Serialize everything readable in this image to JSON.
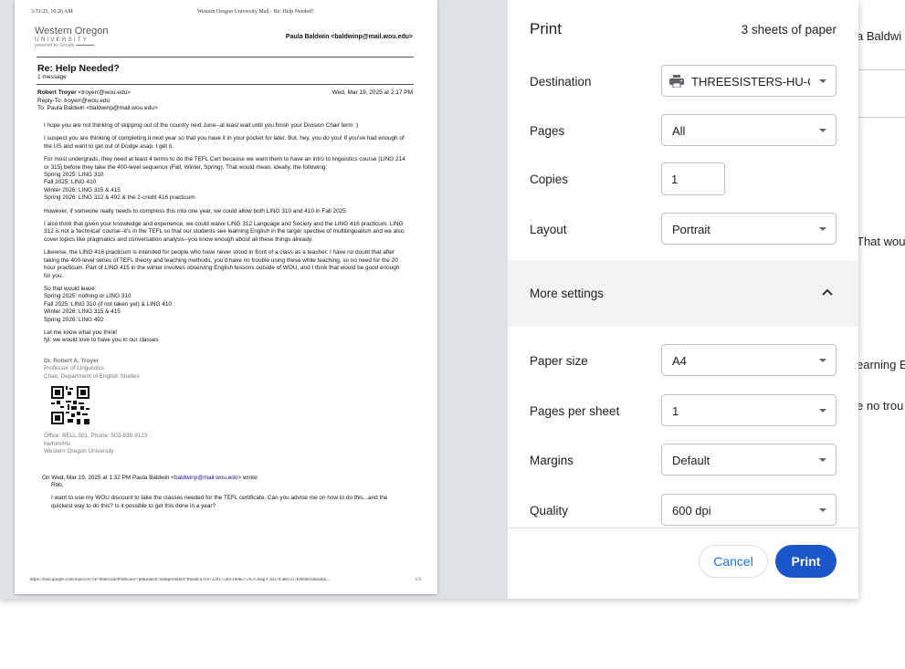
{
  "background": {
    "fragments": [
      "a Baldwi",
      "That woul",
      "earning E",
      "e no trou"
    ]
  },
  "preview": {
    "header_datetime": "3/31/25, 10:26 AM",
    "header_title": "Western Oregon University Mail - Re: Help Needed?",
    "logo": {
      "line1": "Western Oregon",
      "line2": "UNIVERSITY",
      "line3": "powered by Google"
    },
    "user": "Paula Baldwin <baldwinp@mail.wou.edu>",
    "subject": "Re: Help Needed?",
    "message_count": "1 message",
    "from_name": "Robert Troyer",
    "from_email": " <troyerr@wou.edu>",
    "reply_to": "Reply-To: troyerr@wou.edu",
    "to": "To: Paula Baldwin <baldwinp@mail.wou.edu>",
    "date": "Wed, Mar 19, 2025 at 2:17 PM",
    "paragraphs": [
      "I hope you are not thinking of skipping out of the country next June--at least wait until you finish your Division Chair term :)",
      "I suspect you are thinking of completing it next year so that you have it in your pocket for later. But, hey, you do you! If you've had enough of the US and want to get out of Dodge asap, I get it.",
      "For most undergrads, they need at least 4 terms to do the TEFL Cert because we want them to have an intro to linguistics course (LING 214 or 315) before they take the 400-level sequence (Fall, Winter, Spring). That would mean, ideally, the following:\nSpring 2025: LING 310\nFall 2025: LING 410\nWinter 2026: LING 315 & 415\nSpring 2026: LING 312 & 492 & the 2-credit 416 practicum",
      "However, if someone really needs to compress this into one year, we could allow both LING 310 and 410 in Fall 2025.",
      "I also think that given your knowledge and experience, we could waive LING 312 Language and Society and the LING 416 practicum. LING 312 is not a 'technical' course--it's in the TEFL so that our students see learning English in the larger spective of multilingualism and we also cover topics like pragmatics and conversation analysis--you know enough about all these things already.",
      "Likewise, the LING 416 practicum is intended for people who have never stood in front of a class as a teacher. I have no doubt that after taking the 400-level series of TEFL theory and teaching methods, you'd have no trouble using these while teaching, so no need for the 20 hour practicum. Part of LING 415 in the winter involves observing English lessons outside of WOU, and I think that would be good enough for you.",
      "So that would leave:\nSpring 2025: nothing or LING 310\nFall 2025: LING 310 (if not taken yet) & LING 410\nWinter 2026: LING 315 & 415\nSpring 2026: LING 492",
      "Let me know what you think!\nfyi: we would love to have you in our classes"
    ],
    "signature": {
      "name": "Dr. Robert A. Troyer",
      "title": "Professor of Linguistics",
      "dept": "Chair, Department of English Studies",
      "office": "Office: BELL 301, Phone: 503-838-9123",
      "pronouns": "he/him/his",
      "university": "Western Oregon University"
    },
    "quoted_header_pre": "On Wed, Mar 19, 2025 at 1:32 PM Paula Baldwin <",
    "quoted_header_email": "baldwinp@mail.wou.edu",
    "quoted_header_post": "> wrote:",
    "quoted_greeting": "Rob,",
    "quoted_text": "I want to use my WOU discount to take the classes needed for the TEFL certificate.  Can you advise me on how to do this...and the quickest way to do this? Is it possible to get this done in a year?",
    "footer_url": "https://mail.google.com/mail/u/0/?ik=8ba054d0f69&view=pt&search=all&permthid=thread-a:r1673201754851888275%7Cmsg-f:1827058813178484605&simpl...",
    "footer_page": "1/3"
  },
  "settings": {
    "title": "Print",
    "sheets": "3 sheets of paper",
    "destination_label": "Destination",
    "destination_value": "THREESISTERS-HU-C",
    "pages_label": "Pages",
    "pages_value": "All",
    "copies_label": "Copies",
    "copies_value": "1",
    "layout_label": "Layout",
    "layout_value": "Portrait",
    "more_settings_label": "More settings",
    "paper_size_label": "Paper size",
    "paper_size_value": "A4",
    "pages_per_sheet_label": "Pages per sheet",
    "pages_per_sheet_value": "1",
    "margins_label": "Margins",
    "margins_value": "Default",
    "quality_label": "Quality",
    "quality_value": "600 dpi",
    "cancel_label": "Cancel",
    "print_label": "Print"
  },
  "colors": {
    "accent": "#1a56c9",
    "link": "#1a73e8",
    "preview_bg": "#dee1e6"
  },
  "icons": [
    "printer-icon",
    "chevron-up-icon",
    "chevron-down-icon",
    "qr-code-icon"
  ]
}
